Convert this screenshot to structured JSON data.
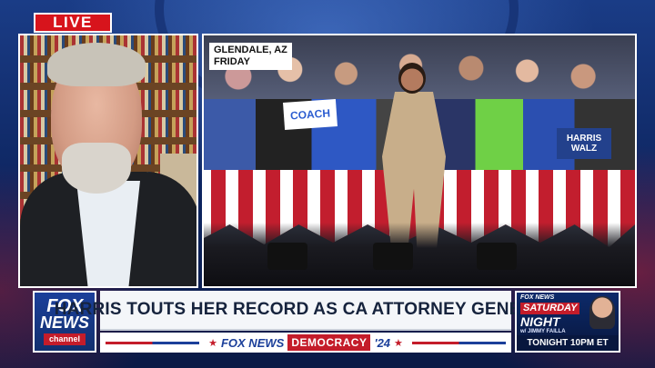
{
  "live_badge": {
    "label": "LIVE"
  },
  "location_tag": {
    "line1": "GLENDALE, AZ",
    "line2": "FRIDAY"
  },
  "crowd_signs": {
    "coach": "COACH",
    "harris_line1": "HARRIS",
    "harris_line2": "WALZ"
  },
  "network_logo": {
    "line1": "FOX",
    "line2": "NEWS",
    "line3": "channel"
  },
  "headline": {
    "text": "HARRIS TOUTS HER RECORD AS CA ATTORNEY GENERAL"
  },
  "ticker": {
    "brand": "FOX NEWS",
    "label": "DEMOCRACY",
    "year": "'24"
  },
  "promo": {
    "network": "FOX NEWS",
    "show_line1": "SATURDAY",
    "show_line2": "NIGHT",
    "host": "w/ JIMMY FAILLA",
    "time": "TONIGHT 10PM ET"
  },
  "colors": {
    "fox_blue": "#1b3f9a",
    "fox_red": "#c41c2a",
    "headline_text": "#16233d"
  }
}
